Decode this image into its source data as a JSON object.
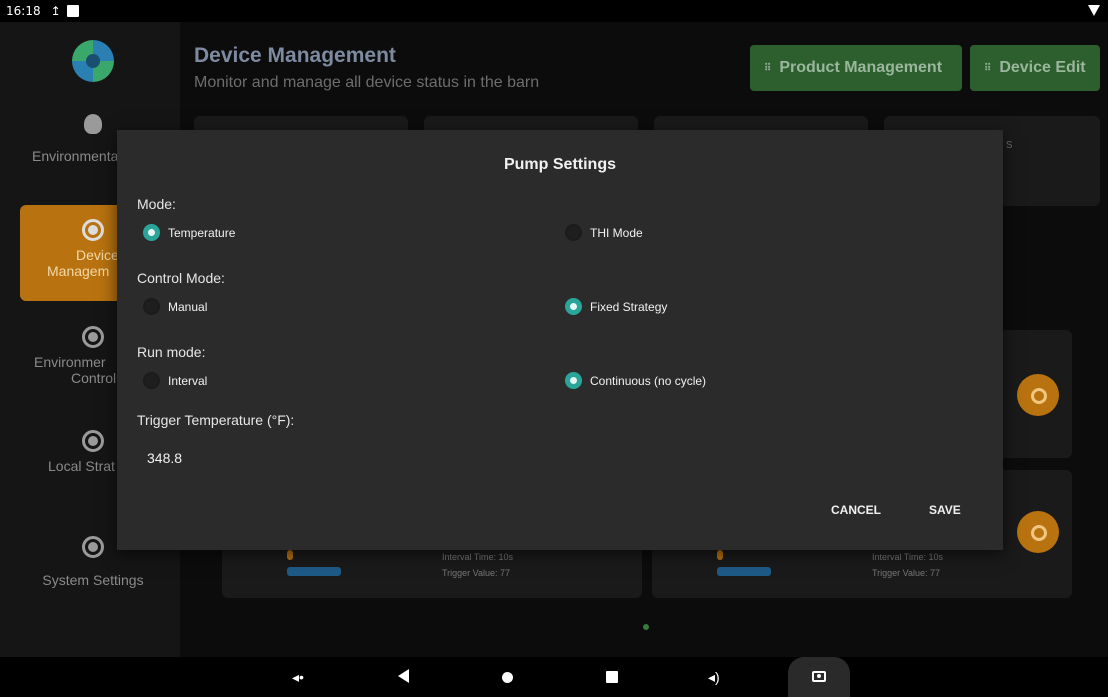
{
  "status_bar": {
    "time": "16:18",
    "upload_glyph": "↥"
  },
  "sidebar": {
    "items": [
      {
        "label": "Environmenta",
        "icon": "lightbulb-icon"
      },
      {
        "label": "Device",
        "label2": "Managem",
        "icon": "device-icon",
        "active": true
      },
      {
        "label": "Environmer",
        "label2": "Control",
        "icon": "target-icon"
      },
      {
        "label": "Local Strat",
        "icon": "strategy-icon"
      },
      {
        "label": "System Settings",
        "icon": "settings-icon"
      }
    ]
  },
  "header": {
    "title": "Device Management",
    "subtitle": "Monitor and manage all device status in the barn",
    "product_button": "Product Management",
    "edit_button": "Device Edit",
    "grip_glyph": "⠿"
  },
  "background": {
    "stat_card_fragment": "s",
    "cards": [
      {
        "interval": "Interval Time: 10s",
        "trigger": "Trigger Value: 77"
      },
      {
        "interval": "Interval Time: 10s",
        "trigger": "Trigger Value: 77"
      }
    ]
  },
  "dialog": {
    "title": "Pump Settings",
    "mode_label": "Mode:",
    "mode_options": [
      "Temperature",
      "THI Mode"
    ],
    "mode_selected": "Temperature",
    "control_label": "Control Mode:",
    "control_options": [
      "Manual",
      "Fixed Strategy"
    ],
    "control_selected": "Fixed Strategy",
    "run_label": "Run mode:",
    "run_options": [
      "Interval",
      "Continuous (no cycle)"
    ],
    "run_selected": "Continuous (no cycle)",
    "trigger_label": "Trigger Temperature (°F):",
    "trigger_value": "348.8",
    "cancel": "CANCEL",
    "save": "SAVE"
  },
  "colors": {
    "accent_orange": "#b8720f",
    "accent_green": "#2c5e2e",
    "radio_teal": "#2aa59a",
    "dialog_bg": "#2b2b2b"
  }
}
